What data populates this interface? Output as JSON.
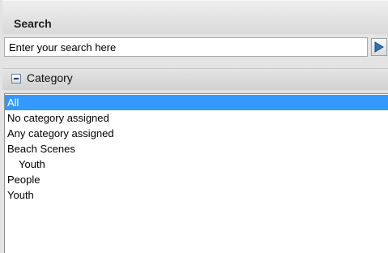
{
  "search": {
    "title": "Search",
    "placeholder": "Enter your search here",
    "value": ""
  },
  "category": {
    "title": "Category",
    "items": [
      {
        "label": "All",
        "selected": true,
        "level": 0
      },
      {
        "label": "No category assigned",
        "selected": false,
        "level": 0
      },
      {
        "label": "Any category assigned",
        "selected": false,
        "level": 0
      },
      {
        "label": "Beach Scenes",
        "selected": false,
        "level": 0
      },
      {
        "label": "Youth",
        "selected": false,
        "level": 1
      },
      {
        "label": "People",
        "selected": false,
        "level": 0
      },
      {
        "label": "Youth",
        "selected": false,
        "level": 0
      }
    ]
  },
  "colors": {
    "selection": "#3399ff",
    "header": "#d9d9d9"
  },
  "icons": {
    "go": "play-arrow-icon",
    "collapse": "minus-box-icon"
  }
}
